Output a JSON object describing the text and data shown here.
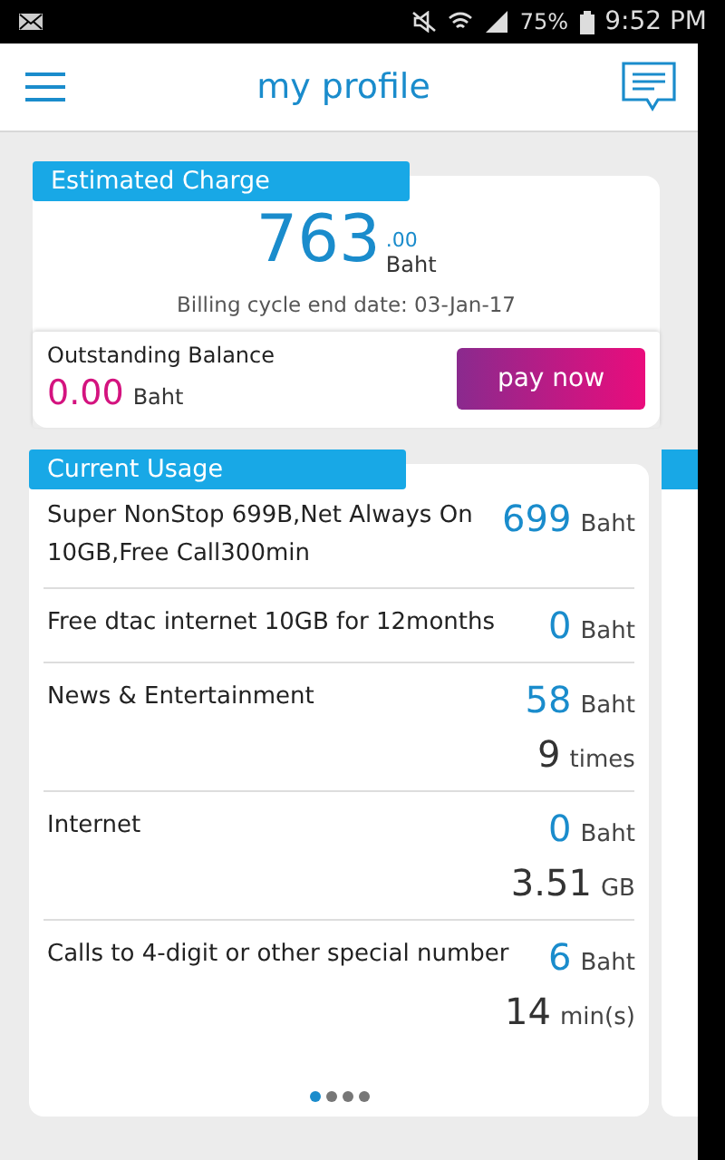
{
  "status_bar": {
    "battery": "75%",
    "time": "9:52 PM"
  },
  "app_bar": {
    "title": "my profile"
  },
  "estimated_charge": {
    "title": "Estimated Charge",
    "amount": "763",
    "decimals": ".00",
    "unit": "Baht",
    "billing_cycle": "Billing cycle end date: 03-Jan-17"
  },
  "outstanding": {
    "label": "Outstanding Balance",
    "amount": "0.00",
    "unit": "Baht",
    "button": "pay now"
  },
  "current_usage": {
    "title": "Current Usage",
    "items": [
      {
        "name": "Super NonStop 699B,Net Always On 10GB,Free Call300min",
        "charge": "699",
        "charge_unit": "Baht"
      },
      {
        "name": "Free dtac internet 10GB for 12months",
        "charge": "0",
        "charge_unit": "Baht"
      },
      {
        "name": "News & Entertainment",
        "charge": "58",
        "charge_unit": "Baht",
        "usage": "9",
        "usage_unit": "times"
      },
      {
        "name": "Internet",
        "charge": "0",
        "charge_unit": "Baht",
        "usage": "3.51",
        "usage_unit": "GB"
      },
      {
        "name": "Calls to 4-digit or other special number",
        "charge": "6",
        "charge_unit": "Baht",
        "usage": "14",
        "usage_unit": "min(s)"
      }
    ],
    "pages": [
      {
        "selected": true
      },
      {
        "selected": false
      },
      {
        "selected": false
      },
      {
        "selected": false
      }
    ]
  }
}
